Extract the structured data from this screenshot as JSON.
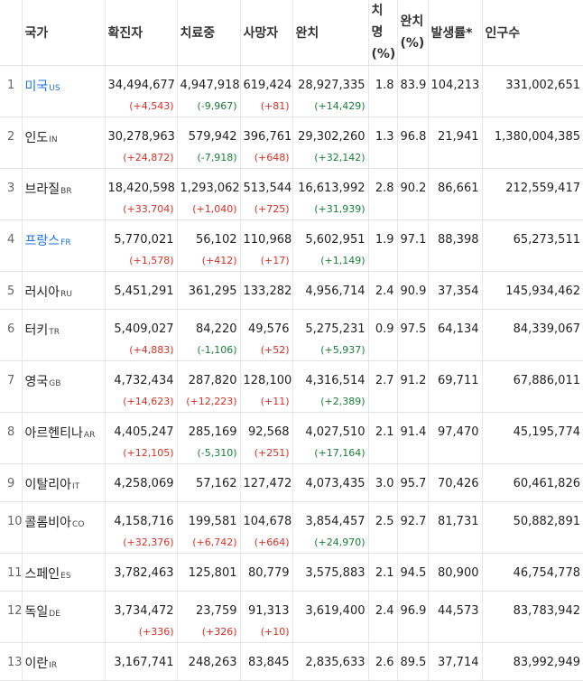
{
  "headers": {
    "country": "국가",
    "confirmed": "확진자",
    "treating": "치료중",
    "deaths": "사망자",
    "recovered": "완치",
    "fatality_line1": "치명",
    "fatality_line2": "(%)",
    "recovery_line1": "완치",
    "recovery_line2": "(%)",
    "incidence": "발생률*",
    "population": "인구수"
  },
  "rows": [
    {
      "rank": "1",
      "name": "미국",
      "code": "US",
      "link": true,
      "confirmed": "34,494,677",
      "confirmed_delta": "(+4,543)",
      "treating": "4,947,918",
      "treating_delta": "(-9,967)",
      "deaths": "619,424",
      "deaths_delta": "(+81)",
      "recovered": "28,927,335",
      "recovered_delta": "(+14,429)",
      "fatality": "1.8",
      "recovery": "83.9",
      "incidence": "104,213",
      "population": "331,002,651"
    },
    {
      "rank": "2",
      "name": "인도",
      "code": "IN",
      "link": false,
      "confirmed": "30,278,963",
      "confirmed_delta": "(+24,872)",
      "treating": "579,942",
      "treating_delta": "(-7,918)",
      "deaths": "396,761",
      "deaths_delta": "(+648)",
      "recovered": "29,302,260",
      "recovered_delta": "(+32,142)",
      "fatality": "1.3",
      "recovery": "96.8",
      "incidence": "21,941",
      "population": "1,380,004,385"
    },
    {
      "rank": "3",
      "name": "브라질",
      "code": "BR",
      "link": false,
      "confirmed": "18,420,598",
      "confirmed_delta": "(+33,704)",
      "treating": "1,293,062",
      "treating_delta": "(+1,040)",
      "deaths": "513,544",
      "deaths_delta": "(+725)",
      "recovered": "16,613,992",
      "recovered_delta": "(+31,939)",
      "fatality": "2.8",
      "recovery": "90.2",
      "incidence": "86,661",
      "population": "212,559,417"
    },
    {
      "rank": "4",
      "name": "프랑스",
      "code": "FR",
      "link": true,
      "confirmed": "5,770,021",
      "confirmed_delta": "(+1,578)",
      "treating": "56,102",
      "treating_delta": "(+412)",
      "deaths": "110,968",
      "deaths_delta": "(+17)",
      "recovered": "5,602,951",
      "recovered_delta": "(+1,149)",
      "fatality": "1.9",
      "recovery": "97.1",
      "incidence": "88,398",
      "population": "65,273,511"
    },
    {
      "rank": "5",
      "name": "러시아",
      "code": "RU",
      "link": false,
      "confirmed": "5,451,291",
      "confirmed_delta": "",
      "treating": "361,295",
      "treating_delta": "",
      "deaths": "133,282",
      "deaths_delta": "",
      "recovered": "4,956,714",
      "recovered_delta": "",
      "fatality": "2.4",
      "recovery": "90.9",
      "incidence": "37,354",
      "population": "145,934,462"
    },
    {
      "rank": "6",
      "name": "터키",
      "code": "TR",
      "link": false,
      "confirmed": "5,409,027",
      "confirmed_delta": "(+4,883)",
      "treating": "84,220",
      "treating_delta": "(-1,106)",
      "deaths": "49,576",
      "deaths_delta": "(+52)",
      "recovered": "5,275,231",
      "recovered_delta": "(+5,937)",
      "fatality": "0.9",
      "recovery": "97.5",
      "incidence": "64,134",
      "population": "84,339,067"
    },
    {
      "rank": "7",
      "name": "영국",
      "code": "GB",
      "link": false,
      "confirmed": "4,732,434",
      "confirmed_delta": "(+14,623)",
      "treating": "287,820",
      "treating_delta": "(+12,223)",
      "deaths": "128,100",
      "deaths_delta": "(+11)",
      "recovered": "4,316,514",
      "recovered_delta": "(+2,389)",
      "fatality": "2.7",
      "recovery": "91.2",
      "incidence": "69,711",
      "population": "67,886,011"
    },
    {
      "rank": "8",
      "name": "아르헨티나",
      "code": "AR",
      "link": false,
      "confirmed": "4,405,247",
      "confirmed_delta": "(+12,105)",
      "treating": "285,169",
      "treating_delta": "(-5,310)",
      "deaths": "92,568",
      "deaths_delta": "(+251)",
      "recovered": "4,027,510",
      "recovered_delta": "(+17,164)",
      "fatality": "2.1",
      "recovery": "91.4",
      "incidence": "97,470",
      "population": "45,195,774"
    },
    {
      "rank": "9",
      "name": "이탈리아",
      "code": "IT",
      "link": false,
      "confirmed": "4,258,069",
      "confirmed_delta": "",
      "treating": "57,162",
      "treating_delta": "",
      "deaths": "127,472",
      "deaths_delta": "",
      "recovered": "4,073,435",
      "recovered_delta": "",
      "fatality": "3.0",
      "recovery": "95.7",
      "incidence": "70,426",
      "population": "60,461,826"
    },
    {
      "rank": "10",
      "name": "콜롬비아",
      "code": "CO",
      "link": false,
      "confirmed": "4,158,716",
      "confirmed_delta": "(+32,376)",
      "treating": "199,581",
      "treating_delta": "(+6,742)",
      "deaths": "104,678",
      "deaths_delta": "(+664)",
      "recovered": "3,854,457",
      "recovered_delta": "(+24,970)",
      "fatality": "2.5",
      "recovery": "92.7",
      "incidence": "81,731",
      "population": "50,882,891"
    },
    {
      "rank": "11",
      "name": "스페인",
      "code": "ES",
      "link": false,
      "confirmed": "3,782,463",
      "confirmed_delta": "",
      "treating": "125,801",
      "treating_delta": "",
      "deaths": "80,779",
      "deaths_delta": "",
      "recovered": "3,575,883",
      "recovered_delta": "",
      "fatality": "2.1",
      "recovery": "94.5",
      "incidence": "80,900",
      "population": "46,754,778"
    },
    {
      "rank": "12",
      "name": "독일",
      "code": "DE",
      "link": false,
      "confirmed": "3,734,472",
      "confirmed_delta": "(+336)",
      "treating": "23,759",
      "treating_delta": "(+326)",
      "deaths": "91,313",
      "deaths_delta": "(+10)",
      "recovered": "3,619,400",
      "recovered_delta": "",
      "fatality": "2.4",
      "recovery": "96.9",
      "incidence": "44,573",
      "population": "83,783,942"
    },
    {
      "rank": "13",
      "name": "이란",
      "code": "IR",
      "link": false,
      "confirmed": "3,167,741",
      "confirmed_delta": "",
      "treating": "248,263",
      "treating_delta": "",
      "deaths": "83,845",
      "deaths_delta": "",
      "recovered": "2,835,633",
      "recovered_delta": "",
      "fatality": "2.6",
      "recovery": "89.5",
      "incidence": "37,714",
      "population": "83,992,949"
    }
  ],
  "colors": {
    "increase": "#d93025",
    "decrease": "#188038",
    "link": "#1a73e8"
  }
}
